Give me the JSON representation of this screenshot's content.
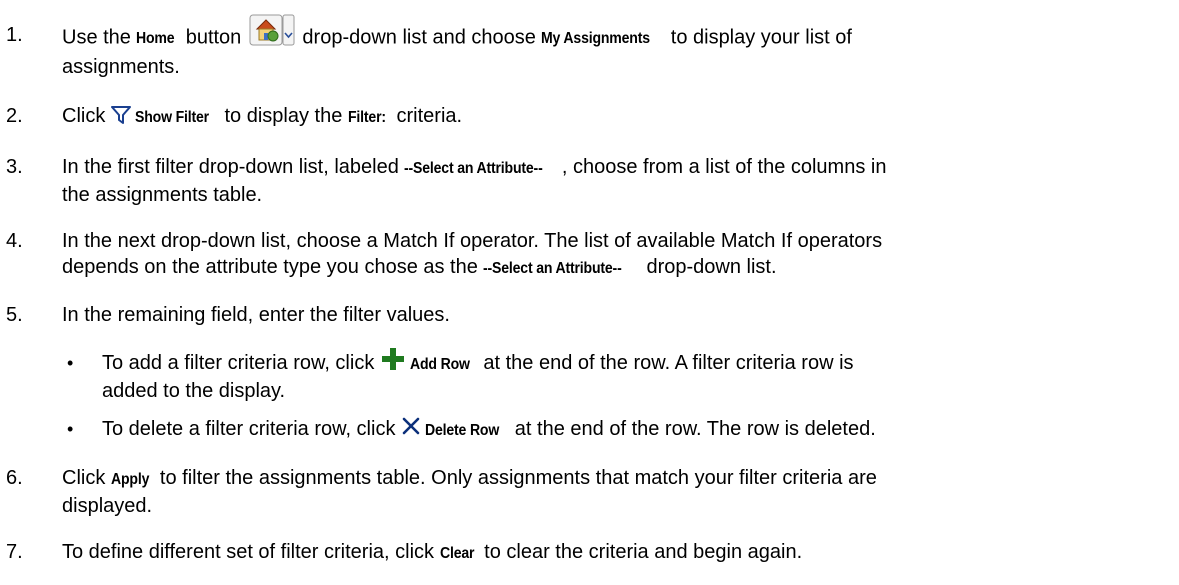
{
  "steps": [
    {
      "num": "1.",
      "a": "Use the ",
      "b": "Home",
      "c": " button ",
      "d": " drop-down list and choose ",
      "e": "My Assignments",
      "f": " to display your list of",
      "g": "assignments."
    },
    {
      "num": "2.",
      "a": "Click ",
      "b": "Show Filter",
      "c": " to display the ",
      "d": "Filter:",
      "e": " criteria."
    },
    {
      "num": "3.",
      "a": "In the first filter drop-down list, labeled ",
      "b": "--Select an Attribute--",
      "c": ", choose from a list of the columns in",
      "d": "the assignments table."
    },
    {
      "num": "4.",
      "a": "In the next drop-down list, choose a Match If operator. The list of available Match If operators",
      "b": "depends on the attribute type you chose as the ",
      "c": "--Select an Attribute--",
      "d": " drop-down list."
    },
    {
      "num": "5.",
      "a": "In the remaining field, enter the filter values."
    },
    {
      "num": "6.",
      "a": "Click ",
      "b": "Apply",
      "c": " to filter the assignments table. Only assignments that match your filter criteria are",
      "d": "displayed."
    },
    {
      "num": "7.",
      "a": "To define different set of filter criteria, click ",
      "b": "Clear",
      "c": " to clear the criteria and begin again."
    }
  ],
  "bullets": [
    {
      "a": "To add a filter criteria row, click ",
      "b": "Add Row",
      "c": " at the end of the row. A filter criteria row is",
      "d": "added to the display."
    },
    {
      "a": "To delete a filter criteria row, click ",
      "b": "Delete Row",
      "c": " at the end of the row. The row is deleted."
    }
  ],
  "bullet_glyph": "•",
  "icons": {
    "home": "home-dropdown-icon",
    "filter": "filter-funnel-icon",
    "add": "plus-icon",
    "delete": "x-icon"
  },
  "colors": {
    "add_icon": "#1f7a1f",
    "delete_icon": "#0b2f7a",
    "filter_icon": "#1a3f8f"
  }
}
